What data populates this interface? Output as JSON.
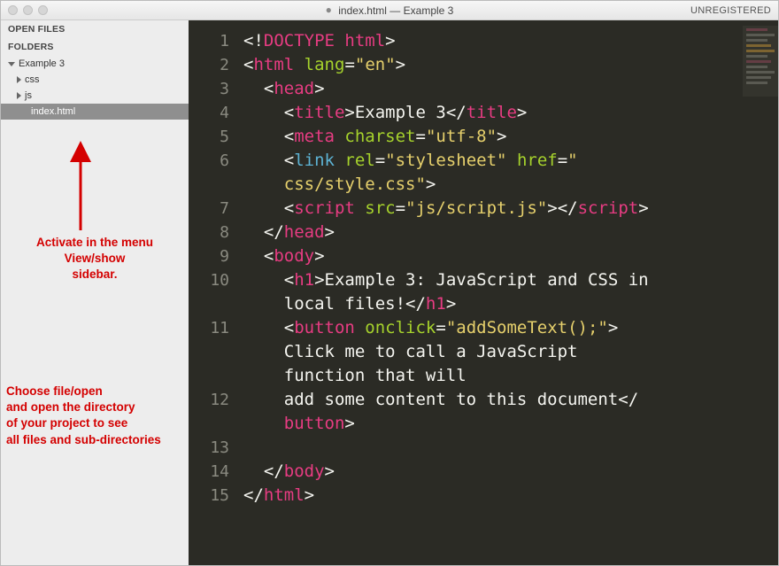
{
  "titlebar": {
    "filename": "index.html",
    "project": "Example 3",
    "unregistered": "UNREGISTERED"
  },
  "sidebar": {
    "open_files_label": "OPEN FILES",
    "folders_label": "FOLDERS",
    "root": "Example 3",
    "items": [
      {
        "name": "css",
        "kind": "folder"
      },
      {
        "name": "js",
        "kind": "folder"
      },
      {
        "name": "index.html",
        "kind": "file",
        "selected": true
      }
    ]
  },
  "annotations": {
    "top": "Activate in the menu\nView/show\nsidebar.",
    "bottom": "Choose file/open\nand open the directory\nof your project to see\nall files and sub-directories"
  },
  "code": {
    "line_numbers": [
      "1",
      "2",
      "3",
      "4",
      "5",
      "6",
      "",
      "7",
      "8",
      "9",
      "10",
      "",
      "11",
      "",
      "",
      "12",
      "",
      "13",
      "14",
      "15"
    ],
    "lines": [
      [
        {
          "t": "<!",
          "c": "w"
        },
        {
          "t": "DOCTYPE html",
          "c": "tg"
        },
        {
          "t": ">",
          "c": "w"
        }
      ],
      [
        {
          "t": "<",
          "c": "w"
        },
        {
          "t": "html",
          "c": "tg"
        },
        {
          "t": " ",
          "c": "w"
        },
        {
          "t": "lang",
          "c": "at"
        },
        {
          "t": "=",
          "c": "w"
        },
        {
          "t": "\"en\"",
          "c": "st"
        },
        {
          "t": ">",
          "c": "w"
        }
      ],
      [
        {
          "t": "  <",
          "c": "w"
        },
        {
          "t": "head",
          "c": "tg"
        },
        {
          "t": ">",
          "c": "w"
        }
      ],
      [
        {
          "t": "    <",
          "c": "w"
        },
        {
          "t": "title",
          "c": "tg"
        },
        {
          "t": ">",
          "c": "w"
        },
        {
          "t": "Example 3",
          "c": "w"
        },
        {
          "t": "</",
          "c": "w"
        },
        {
          "t": "title",
          "c": "tg"
        },
        {
          "t": ">",
          "c": "w"
        }
      ],
      [
        {
          "t": "    <",
          "c": "w"
        },
        {
          "t": "meta",
          "c": "tg"
        },
        {
          "t": " ",
          "c": "w"
        },
        {
          "t": "charset",
          "c": "at"
        },
        {
          "t": "=",
          "c": "w"
        },
        {
          "t": "\"utf-8\"",
          "c": "st"
        },
        {
          "t": ">",
          "c": "w"
        }
      ],
      [
        {
          "t": "    <",
          "c": "w"
        },
        {
          "t": "link",
          "c": "kw"
        },
        {
          "t": " ",
          "c": "w"
        },
        {
          "t": "rel",
          "c": "at"
        },
        {
          "t": "=",
          "c": "w"
        },
        {
          "t": "\"stylesheet\"",
          "c": "st"
        },
        {
          "t": " ",
          "c": "w"
        },
        {
          "t": "href",
          "c": "at"
        },
        {
          "t": "=",
          "c": "w"
        },
        {
          "t": "\"",
          "c": "st"
        }
      ],
      [
        {
          "t": "    css/style.css\"",
          "c": "st"
        },
        {
          "t": ">",
          "c": "w"
        }
      ],
      [
        {
          "t": "    <",
          "c": "w"
        },
        {
          "t": "script",
          "c": "tg"
        },
        {
          "t": " ",
          "c": "w"
        },
        {
          "t": "src",
          "c": "at"
        },
        {
          "t": "=",
          "c": "w"
        },
        {
          "t": "\"js/script.js\"",
          "c": "st"
        },
        {
          "t": ">",
          "c": "w"
        },
        {
          "t": "</",
          "c": "w"
        },
        {
          "t": "script",
          "c": "tg"
        },
        {
          "t": ">",
          "c": "w"
        }
      ],
      [
        {
          "t": "  </",
          "c": "w"
        },
        {
          "t": "head",
          "c": "tg"
        },
        {
          "t": ">",
          "c": "w"
        }
      ],
      [
        {
          "t": "  <",
          "c": "w"
        },
        {
          "t": "body",
          "c": "tg"
        },
        {
          "t": ">",
          "c": "w"
        }
      ],
      [
        {
          "t": "    <",
          "c": "w"
        },
        {
          "t": "h1",
          "c": "tg"
        },
        {
          "t": ">",
          "c": "w"
        },
        {
          "t": "Example 3: JavaScript and CSS in",
          "c": "w"
        }
      ],
      [
        {
          "t": "    local files!",
          "c": "w"
        },
        {
          "t": "</",
          "c": "w"
        },
        {
          "t": "h1",
          "c": "tg"
        },
        {
          "t": ">",
          "c": "w"
        }
      ],
      [
        {
          "t": "    <",
          "c": "w"
        },
        {
          "t": "button",
          "c": "tg"
        },
        {
          "t": " ",
          "c": "w"
        },
        {
          "t": "onclick",
          "c": "at"
        },
        {
          "t": "=",
          "c": "w"
        },
        {
          "t": "\"addSomeText();\"",
          "c": "st"
        },
        {
          "t": ">",
          "c": "w"
        }
      ],
      [
        {
          "t": "    Click me to call a JavaScript",
          "c": "w"
        }
      ],
      [
        {
          "t": "    function that will",
          "c": "w"
        }
      ],
      [
        {
          "t": "    add some content to this document",
          "c": "w"
        },
        {
          "t": "</",
          "c": "w"
        }
      ],
      [
        {
          "t": "    ",
          "c": "w"
        },
        {
          "t": "button",
          "c": "tg"
        },
        {
          "t": ">",
          "c": "w"
        }
      ],
      [
        {
          "t": "",
          "c": "w"
        }
      ],
      [
        {
          "t": "  </",
          "c": "w"
        },
        {
          "t": "body",
          "c": "tg"
        },
        {
          "t": ">",
          "c": "w"
        }
      ],
      [
        {
          "t": "</",
          "c": "w"
        },
        {
          "t": "html",
          "c": "tg"
        },
        {
          "t": ">",
          "c": "w"
        }
      ]
    ]
  }
}
